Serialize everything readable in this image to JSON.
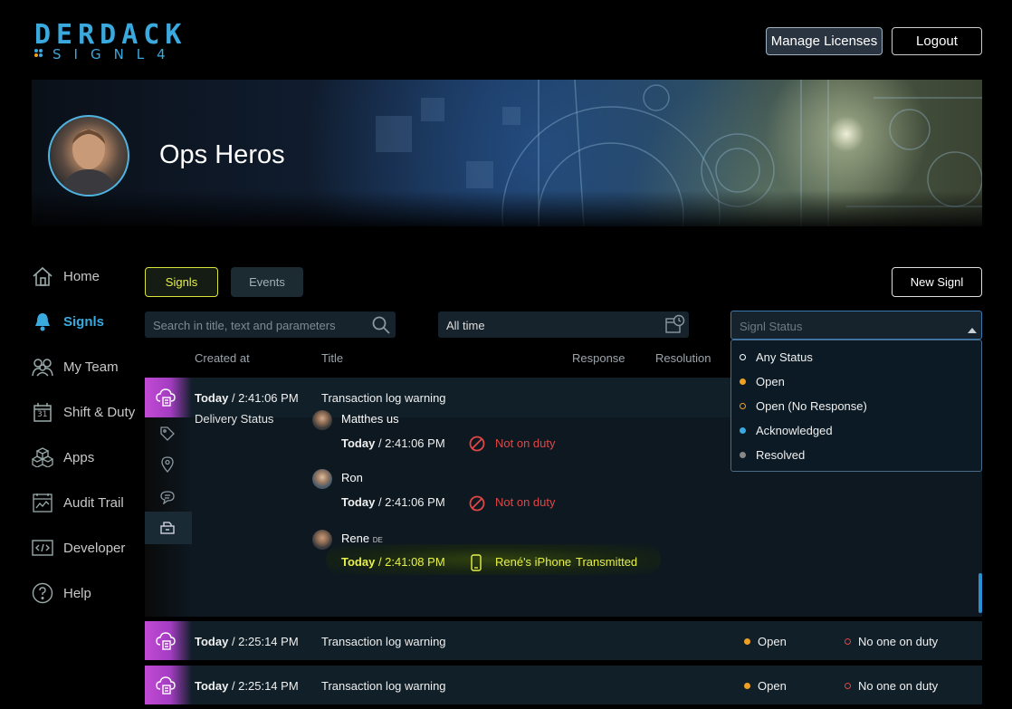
{
  "header": {
    "logo_word": "DERDACK",
    "logo_product": "SIGNL4",
    "manage_licenses": "Manage Licenses",
    "logout": "Logout"
  },
  "banner": {
    "team_name": "Ops Heros"
  },
  "sidebar": {
    "items": [
      {
        "label": "Home",
        "icon": "home-icon"
      },
      {
        "label": "Signls",
        "icon": "bell-icon",
        "active": true
      },
      {
        "label": "My Team",
        "icon": "team-icon"
      },
      {
        "label": "Shift & Duty",
        "icon": "calendar-icon"
      },
      {
        "label": "Apps",
        "icon": "cubes-icon"
      },
      {
        "label": "Audit Trail",
        "icon": "audit-icon"
      },
      {
        "label": "Developer",
        "icon": "code-icon"
      },
      {
        "label": "Help",
        "icon": "help-icon"
      }
    ],
    "calendar_day": "31"
  },
  "tabs": {
    "signls": "Signls",
    "events": "Events",
    "new_signl": "New Signl"
  },
  "filters": {
    "search_placeholder": "Search in title, text and parameters",
    "time_value": "All time",
    "status_placeholder": "Signl Status"
  },
  "columns": {
    "created_at": "Created at",
    "title": "Title",
    "response": "Response",
    "resolution": "Resolution"
  },
  "status_dropdown": {
    "options": [
      {
        "label": "Any Status",
        "color": "#ffffff",
        "hollow": true
      },
      {
        "label": "Open",
        "color": "#f0a020",
        "hollow": false
      },
      {
        "label": "Open (No Response)",
        "color": "#f0a020",
        "hollow": true
      },
      {
        "label": "Acknowledged",
        "color": "#3aa9de",
        "hollow": false
      },
      {
        "label": "Resolved",
        "color": "#888888",
        "hollow": false
      }
    ]
  },
  "signls": [
    {
      "date": "Today",
      "time": " / 2:41:06 PM",
      "title": "Transaction log warning",
      "expanded": true
    },
    {
      "date": "Today",
      "time": " / 2:25:14 PM",
      "title": "Transaction log warning",
      "status": "Open",
      "duty": "No one on duty"
    },
    {
      "date": "Today",
      "time": " / 2:25:14 PM",
      "title": "Transaction log warning",
      "status": "Open",
      "duty": "No one on duty"
    }
  ],
  "delivery": {
    "label": "Delivery Status",
    "entries": [
      {
        "name": "Matthes us",
        "date": "Today",
        "time": " / 2:41:06 PM",
        "state": "Not on duty"
      },
      {
        "name": "Ron",
        "date": "Today",
        "time": " / 2:41:06 PM",
        "state": "Not on duty"
      },
      {
        "name": "Rene",
        "name_suffix": "DE",
        "date": "Today",
        "time": " / 2:41:08 PM",
        "device": "René's iPhone",
        "state": "Transmitted"
      }
    ]
  },
  "colors": {
    "accent": "#3aa9de",
    "highlight": "#e7f04a",
    "danger": "#e04646",
    "signl_icon": "#c24ad4"
  }
}
